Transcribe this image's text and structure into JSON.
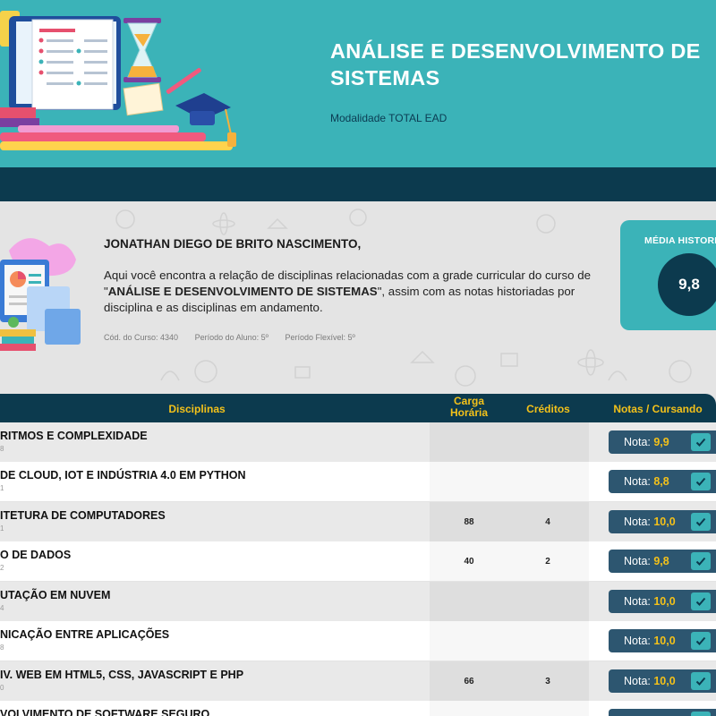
{
  "header": {
    "title_line1": "ANÁLISE E DESENVOLVIMENTO DE",
    "title_line2": "SISTEMAS",
    "modalidade": "Modalidade TOTAL EAD"
  },
  "student": {
    "name": "JONATHAN DIEGO DE BRITO NASCIMENTO,",
    "desc_part1": "Aqui você encontra a relação de disciplinas relacionadas com a grade curricular do curso de \"",
    "desc_course": "ANÁLISE E DESENVOLVIMENTO DE SISTEMAS",
    "desc_part2": "\", assim com as notas historiadas por disciplina e as disciplinas em andamento.",
    "cod_curso": "Cód. do Curso: 4340",
    "periodo_aluno": "Período do Aluno: 5º",
    "periodo_flexivel": "Período Flexível: 5º"
  },
  "media": {
    "label": "MÉDIA HISTORICA",
    "value": "9,8"
  },
  "table": {
    "headers": {
      "disciplinas": "Disciplinas",
      "carga_line1": "Carga",
      "carga_line2": "Horária",
      "creditos": "Créditos",
      "notas": "Notas / Cursando"
    },
    "rows": [
      {
        "name": "RITMOS E COMPLEXIDADE",
        "code": "8",
        "carga": "",
        "creditos": "",
        "nota_label": "Nota: ",
        "nota": "9,9"
      },
      {
        "name": "DE CLOUD, IOT E INDÚSTRIA 4.0 EM PYTHON",
        "code": "1",
        "carga": "",
        "creditos": "",
        "nota_label": "Nota: ",
        "nota": "8,8"
      },
      {
        "name": "ITETURA DE COMPUTADORES",
        "code": "1",
        "carga": "88",
        "creditos": "4",
        "nota_label": "Nota: ",
        "nota": "10,0"
      },
      {
        "name": "O DE DADOS",
        "code": "2",
        "carga": "40",
        "creditos": "2",
        "nota_label": "Nota: ",
        "nota": "9,8"
      },
      {
        "name": "UTAÇÃO EM NUVEM",
        "code": "4",
        "carga": "",
        "creditos": "",
        "nota_label": "Nota: ",
        "nota": "10,0"
      },
      {
        "name": "NICAÇÃO ENTRE APLICAÇÕES",
        "code": "8",
        "carga": "",
        "creditos": "",
        "nota_label": "Nota: ",
        "nota": "10,0"
      },
      {
        "name": "IV. WEB EM HTML5, CSS, JAVASCRIPT E PHP",
        "code": "0",
        "carga": "66",
        "creditos": "3",
        "nota_label": "Nota: ",
        "nota": "10,0"
      },
      {
        "name": "VOLVIMENTO DE SOFTWARE SEGURO",
        "code": "",
        "carga": "",
        "creditos": "",
        "nota_label": "Nota: ",
        "nota": ""
      }
    ]
  },
  "colors": {
    "teal": "#3bb3b8",
    "navy": "#0c3a4e",
    "gold": "#f3c11a",
    "button": "#2d5670"
  }
}
